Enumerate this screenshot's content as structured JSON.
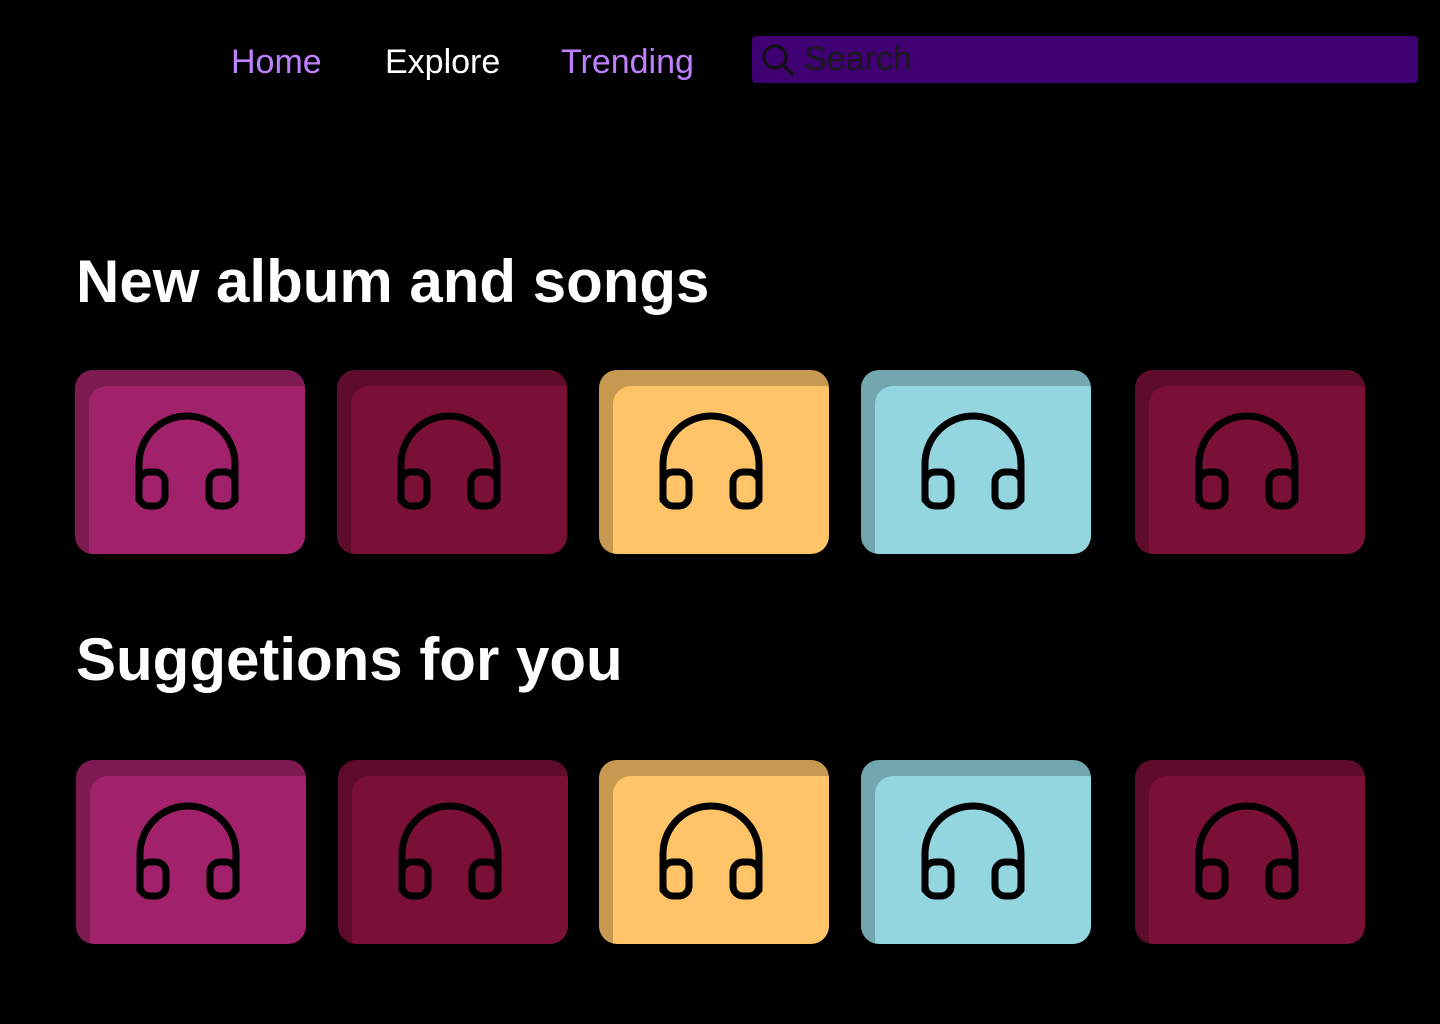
{
  "nav": {
    "links": [
      {
        "label": "Home",
        "color": "#bf80ff"
      },
      {
        "label": "Explore",
        "color": "#ffffff"
      },
      {
        "label": "Trending",
        "color": "#bf80ff"
      }
    ],
    "search": {
      "placeholder": "Search",
      "value": "",
      "icon": "search-icon",
      "background": "#3f0072"
    }
  },
  "sections": [
    {
      "title": "New album and songs",
      "cards": [
        {
          "icon": "headphones-icon",
          "color": "#a1226a"
        },
        {
          "icon": "headphones-icon",
          "color": "#7a1036"
        },
        {
          "icon": "headphones-icon",
          "color": "#ffc467"
        },
        {
          "icon": "headphones-icon",
          "color": "#93d6e0"
        },
        {
          "icon": "headphones-icon",
          "color": "#7a1036"
        }
      ]
    },
    {
      "title": "Suggetions for you",
      "cards": [
        {
          "icon": "headphones-icon",
          "color": "#a1226a"
        },
        {
          "icon": "headphones-icon",
          "color": "#7a1036"
        },
        {
          "icon": "headphones-icon",
          "color": "#ffc467"
        },
        {
          "icon": "headphones-icon",
          "color": "#93d6e0"
        },
        {
          "icon": "headphones-icon",
          "color": "#7a1036"
        }
      ]
    }
  ],
  "theme": {
    "background": "#000000",
    "accent": "#bf80ff",
    "text": "#ffffff"
  }
}
